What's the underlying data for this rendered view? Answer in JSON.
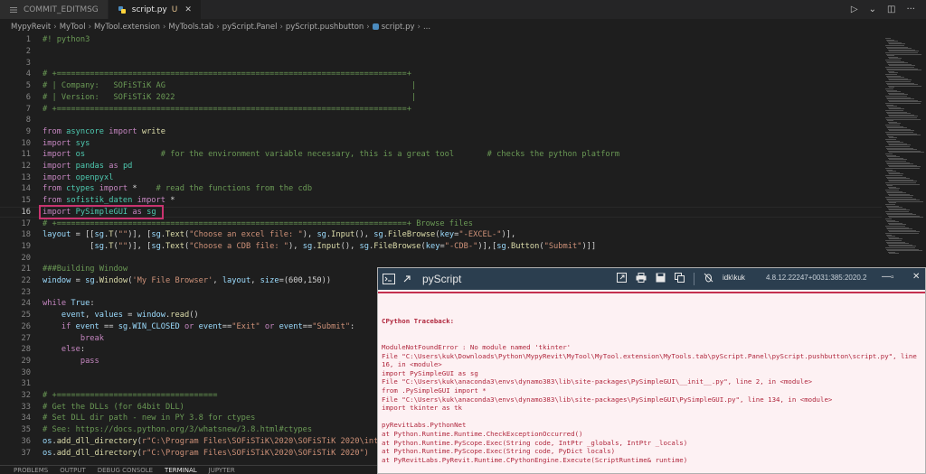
{
  "tabs": [
    {
      "label": "COMMIT_EDITMSG",
      "modified": false,
      "active": false
    },
    {
      "label": "script.py",
      "modified": true,
      "modified_mark": "U",
      "active": true
    }
  ],
  "breadcrumb": [
    "MypyRevit",
    "MyTool",
    "MyTool.extension",
    "MyTools.tab",
    "pyScript.Panel",
    "pyScript.pushbutton",
    "script.py",
    "..."
  ],
  "editor": {
    "current_line": 16,
    "lines": [
      {
        "n": "1",
        "t": [
          {
            "c": "cm",
            "s": "#! python3"
          }
        ]
      },
      {
        "n": "2",
        "t": []
      },
      {
        "n": "3",
        "t": []
      },
      {
        "n": "4",
        "t": [
          {
            "c": "cm",
            "s": "# +==========================================================================+"
          }
        ]
      },
      {
        "n": "5",
        "t": [
          {
            "c": "cm",
            "s": "# | Company:   SOFiSTiK AG                                                    |"
          }
        ]
      },
      {
        "n": "6",
        "t": [
          {
            "c": "cm",
            "s": "# | Version:   SOFiSTiK 2022                                                  |"
          }
        ]
      },
      {
        "n": "7",
        "t": [
          {
            "c": "cm",
            "s": "# +==========================================================================+"
          }
        ]
      },
      {
        "n": "8",
        "t": []
      },
      {
        "n": "9",
        "t": [
          {
            "c": "kw",
            "s": "from "
          },
          {
            "c": "mod-name",
            "s": "asyncore"
          },
          {
            "c": "kw",
            "s": " import "
          },
          {
            "c": "fn",
            "s": "write"
          }
        ]
      },
      {
        "n": "10",
        "t": [
          {
            "c": "kw",
            "s": "import "
          },
          {
            "c": "mod-name",
            "s": "sys"
          }
        ]
      },
      {
        "n": "11",
        "t": [
          {
            "c": "kw",
            "s": "import "
          },
          {
            "c": "mod-name",
            "s": "os"
          },
          {
            "c": "tx",
            "s": "                "
          },
          {
            "c": "cm",
            "s": "# for the environment variable necessary, this is a great tool       # checks the python platform"
          }
        ]
      },
      {
        "n": "12",
        "t": [
          {
            "c": "kw",
            "s": "import "
          },
          {
            "c": "mod-name",
            "s": "pandas"
          },
          {
            "c": "kw",
            "s": " as "
          },
          {
            "c": "mod-name",
            "s": "pd"
          }
        ]
      },
      {
        "n": "13",
        "t": [
          {
            "c": "kw",
            "s": "import "
          },
          {
            "c": "mod-name",
            "s": "openpyxl"
          }
        ]
      },
      {
        "n": "14",
        "t": [
          {
            "c": "kw",
            "s": "from "
          },
          {
            "c": "mod-name",
            "s": "ctypes"
          },
          {
            "c": "kw",
            "s": " import "
          },
          {
            "c": "tx",
            "s": "*    "
          },
          {
            "c": "cm",
            "s": "# read the functions from the cdb"
          }
        ]
      },
      {
        "n": "15",
        "t": [
          {
            "c": "kw",
            "s": "from "
          },
          {
            "c": "mod-name",
            "s": "sofistik_daten"
          },
          {
            "c": "kw",
            "s": " import "
          },
          {
            "c": "tx",
            "s": "*"
          }
        ]
      },
      {
        "n": "16",
        "t": [
          {
            "c": "kw",
            "s": "import "
          },
          {
            "c": "mod-name",
            "s": "PySimpleGUI"
          },
          {
            "c": "kw",
            "s": " as "
          },
          {
            "c": "mod-name",
            "s": "sg"
          }
        ]
      },
      {
        "n": "17",
        "t": [
          {
            "c": "cm",
            "s": "# +==========================================================================+ Browse files"
          }
        ]
      },
      {
        "n": "18",
        "t": [
          {
            "c": "var",
            "s": "layout"
          },
          {
            "c": "tx",
            "s": " = [["
          },
          {
            "c": "var",
            "s": "sg"
          },
          {
            "c": "tx",
            "s": "."
          },
          {
            "c": "fn",
            "s": "T"
          },
          {
            "c": "tx",
            "s": "("
          },
          {
            "c": "st",
            "s": "\"\""
          },
          {
            "c": "tx",
            "s": ")], ["
          },
          {
            "c": "var",
            "s": "sg"
          },
          {
            "c": "tx",
            "s": "."
          },
          {
            "c": "fn",
            "s": "Text"
          },
          {
            "c": "tx",
            "s": "("
          },
          {
            "c": "st",
            "s": "\"Choose an excel file: \""
          },
          {
            "c": "tx",
            "s": "), "
          },
          {
            "c": "var",
            "s": "sg"
          },
          {
            "c": "tx",
            "s": "."
          },
          {
            "c": "fn",
            "s": "Input"
          },
          {
            "c": "tx",
            "s": "(), "
          },
          {
            "c": "var",
            "s": "sg"
          },
          {
            "c": "tx",
            "s": "."
          },
          {
            "c": "fn",
            "s": "FileBrowse"
          },
          {
            "c": "tx",
            "s": "("
          },
          {
            "c": "var",
            "s": "key"
          },
          {
            "c": "tx",
            "s": "="
          },
          {
            "c": "st",
            "s": "\"-EXCEL-\""
          },
          {
            "c": "tx",
            "s": ")],"
          }
        ]
      },
      {
        "n": "19",
        "t": [
          {
            "c": "tx",
            "s": "          ["
          },
          {
            "c": "var",
            "s": "sg"
          },
          {
            "c": "tx",
            "s": "."
          },
          {
            "c": "fn",
            "s": "T"
          },
          {
            "c": "tx",
            "s": "("
          },
          {
            "c": "st",
            "s": "\"\""
          },
          {
            "c": "tx",
            "s": ")], ["
          },
          {
            "c": "var",
            "s": "sg"
          },
          {
            "c": "tx",
            "s": "."
          },
          {
            "c": "fn",
            "s": "Text"
          },
          {
            "c": "tx",
            "s": "("
          },
          {
            "c": "st",
            "s": "\"Choose a CDB file: \""
          },
          {
            "c": "tx",
            "s": "), "
          },
          {
            "c": "var",
            "s": "sg"
          },
          {
            "c": "tx",
            "s": "."
          },
          {
            "c": "fn",
            "s": "Input"
          },
          {
            "c": "tx",
            "s": "(), "
          },
          {
            "c": "var",
            "s": "sg"
          },
          {
            "c": "tx",
            "s": "."
          },
          {
            "c": "fn",
            "s": "FileBrowse"
          },
          {
            "c": "tx",
            "s": "("
          },
          {
            "c": "var",
            "s": "key"
          },
          {
            "c": "tx",
            "s": "="
          },
          {
            "c": "st",
            "s": "\"-CDB-\""
          },
          {
            "c": "tx",
            "s": ")],["
          },
          {
            "c": "var",
            "s": "sg"
          },
          {
            "c": "tx",
            "s": "."
          },
          {
            "c": "fn",
            "s": "Button"
          },
          {
            "c": "tx",
            "s": "("
          },
          {
            "c": "st",
            "s": "\"Submit\""
          },
          {
            "c": "tx",
            "s": ")]]"
          }
        ]
      },
      {
        "n": "20",
        "t": []
      },
      {
        "n": "21",
        "t": [
          {
            "c": "cm",
            "s": "###Building Window"
          }
        ]
      },
      {
        "n": "22",
        "t": [
          {
            "c": "var",
            "s": "window"
          },
          {
            "c": "tx",
            "s": " = "
          },
          {
            "c": "var",
            "s": "sg"
          },
          {
            "c": "tx",
            "s": "."
          },
          {
            "c": "fn",
            "s": "Window"
          },
          {
            "c": "tx",
            "s": "("
          },
          {
            "c": "st",
            "s": "'My File Browser'"
          },
          {
            "c": "tx",
            "s": ", "
          },
          {
            "c": "var",
            "s": "layout"
          },
          {
            "c": "tx",
            "s": ", "
          },
          {
            "c": "var",
            "s": "size"
          },
          {
            "c": "tx",
            "s": "=(600,150))"
          }
        ]
      },
      {
        "n": "23",
        "t": []
      },
      {
        "n": "24",
        "t": [
          {
            "c": "kw",
            "s": "while "
          },
          {
            "c": "var",
            "s": "True"
          },
          {
            "c": "tx",
            "s": ":"
          }
        ]
      },
      {
        "n": "25",
        "t": [
          {
            "c": "tx",
            "s": "    "
          },
          {
            "c": "var",
            "s": "event"
          },
          {
            "c": "tx",
            "s": ", "
          },
          {
            "c": "var",
            "s": "values"
          },
          {
            "c": "tx",
            "s": " = "
          },
          {
            "c": "var",
            "s": "window"
          },
          {
            "c": "tx",
            "s": "."
          },
          {
            "c": "fn",
            "s": "read"
          },
          {
            "c": "tx",
            "s": "()"
          }
        ]
      },
      {
        "n": "26",
        "t": [
          {
            "c": "tx",
            "s": "    "
          },
          {
            "c": "kw",
            "s": "if "
          },
          {
            "c": "var",
            "s": "event"
          },
          {
            "c": "tx",
            "s": " == "
          },
          {
            "c": "var",
            "s": "sg"
          },
          {
            "c": "tx",
            "s": "."
          },
          {
            "c": "var",
            "s": "WIN_CLOSED"
          },
          {
            "c": "kw",
            "s": " or "
          },
          {
            "c": "var",
            "s": "event"
          },
          {
            "c": "tx",
            "s": "=="
          },
          {
            "c": "st",
            "s": "\"Exit\""
          },
          {
            "c": "kw",
            "s": " or "
          },
          {
            "c": "var",
            "s": "event"
          },
          {
            "c": "tx",
            "s": "=="
          },
          {
            "c": "st",
            "s": "\"Submit\""
          },
          {
            "c": "tx",
            "s": ":"
          }
        ]
      },
      {
        "n": "27",
        "t": [
          {
            "c": "tx",
            "s": "        "
          },
          {
            "c": "kw",
            "s": "break"
          }
        ]
      },
      {
        "n": "28",
        "t": [
          {
            "c": "tx",
            "s": "    "
          },
          {
            "c": "kw",
            "s": "else"
          },
          {
            "c": "tx",
            "s": ":"
          }
        ]
      },
      {
        "n": "29",
        "t": [
          {
            "c": "tx",
            "s": "        "
          },
          {
            "c": "kw",
            "s": "pass"
          }
        ]
      },
      {
        "n": "30",
        "t": []
      },
      {
        "n": "31",
        "t": []
      },
      {
        "n": "32",
        "t": [
          {
            "c": "cm",
            "s": "# +=================================="
          }
        ]
      },
      {
        "n": "33",
        "t": [
          {
            "c": "cm",
            "s": "# Get the DLLs (for 64bit DLL)"
          }
        ]
      },
      {
        "n": "34",
        "t": [
          {
            "c": "cm",
            "s": "# Set DLL dir path - new in PY 3.8 for ctypes"
          }
        ]
      },
      {
        "n": "35",
        "t": [
          {
            "c": "cm",
            "s": "# See: https://docs.python.org/3/whatsnew/3.8.html#ctypes"
          }
        ]
      },
      {
        "n": "36",
        "t": [
          {
            "c": "var",
            "s": "os"
          },
          {
            "c": "tx",
            "s": "."
          },
          {
            "c": "fn",
            "s": "add_dll_directory"
          },
          {
            "c": "tx",
            "s": "("
          },
          {
            "c": "st",
            "s": "r\"C:\\Program Files\\SOFiSTiK\\2020\\SOFiSTiK 2020\\inte"
          }
        ]
      },
      {
        "n": "37",
        "t": [
          {
            "c": "var",
            "s": "os"
          },
          {
            "c": "tx",
            "s": "."
          },
          {
            "c": "fn",
            "s": "add_dll_directory"
          },
          {
            "c": "tx",
            "s": "("
          },
          {
            "c": "st",
            "s": "r\"C:\\Program Files\\SOFiSTiK\\2020\\SOFiSTiK 2020\")"
          }
        ]
      }
    ]
  },
  "bottom_panel": {
    "tabs": [
      "PROBLEMS",
      "OUTPUT",
      "DEBUG CONSOLE",
      "TERMINAL",
      "JUPYTER"
    ],
    "active": "TERMINAL"
  },
  "pyscript": {
    "title": "pyScript",
    "user": "idk\\kuk",
    "version": "4.8.12.22247+0031:385:2020.2",
    "output_header": "CPython Traceback:",
    "output_lines": [
      "ModuleNotFoundError : No module named 'tkinter'",
      "File \"C:\\Users\\kuk\\Downloads\\Python\\MypyRevit\\MyTool\\MyTool.extension\\MyTools.tab\\pyScript.Panel\\pyScript.pushbutton\\script.py\", line 16, in <module>",
      "import PySimpleGUI as sg",
      "File \"C:\\Users\\kuk\\anaconda3\\envs\\dynamo383\\lib\\site-packages\\PySimpleGUI\\__init__.py\", line 2, in <module>",
      "from .PySimpleGUI import *",
      "File \"C:\\Users\\kuk\\anaconda3\\envs\\dynamo383\\lib\\site-packages\\PySimpleGUI\\PySimpleGUI.py\", line 134, in <module>",
      "import tkinter as tk",
      "",
      "pyRevitLabs.PythonNet",
      "at Python.Runtime.Runtime.CheckExceptionOccurred()",
      "at Python.Runtime.PyScope.Exec(String code, IntPtr _globals, IntPtr _locals)",
      "at Python.Runtime.PyScope.Exec(String code, PyDict locals)",
      "at PyRevitLabs.PyRevit.Runtime.CPythonEngine.Execute(ScriptRuntime& runtime)"
    ]
  },
  "colors": {
    "accent_highlight": "#c9336f",
    "error_text": "#b0273d",
    "pyscript_titlebar": "#2b3e4f"
  }
}
